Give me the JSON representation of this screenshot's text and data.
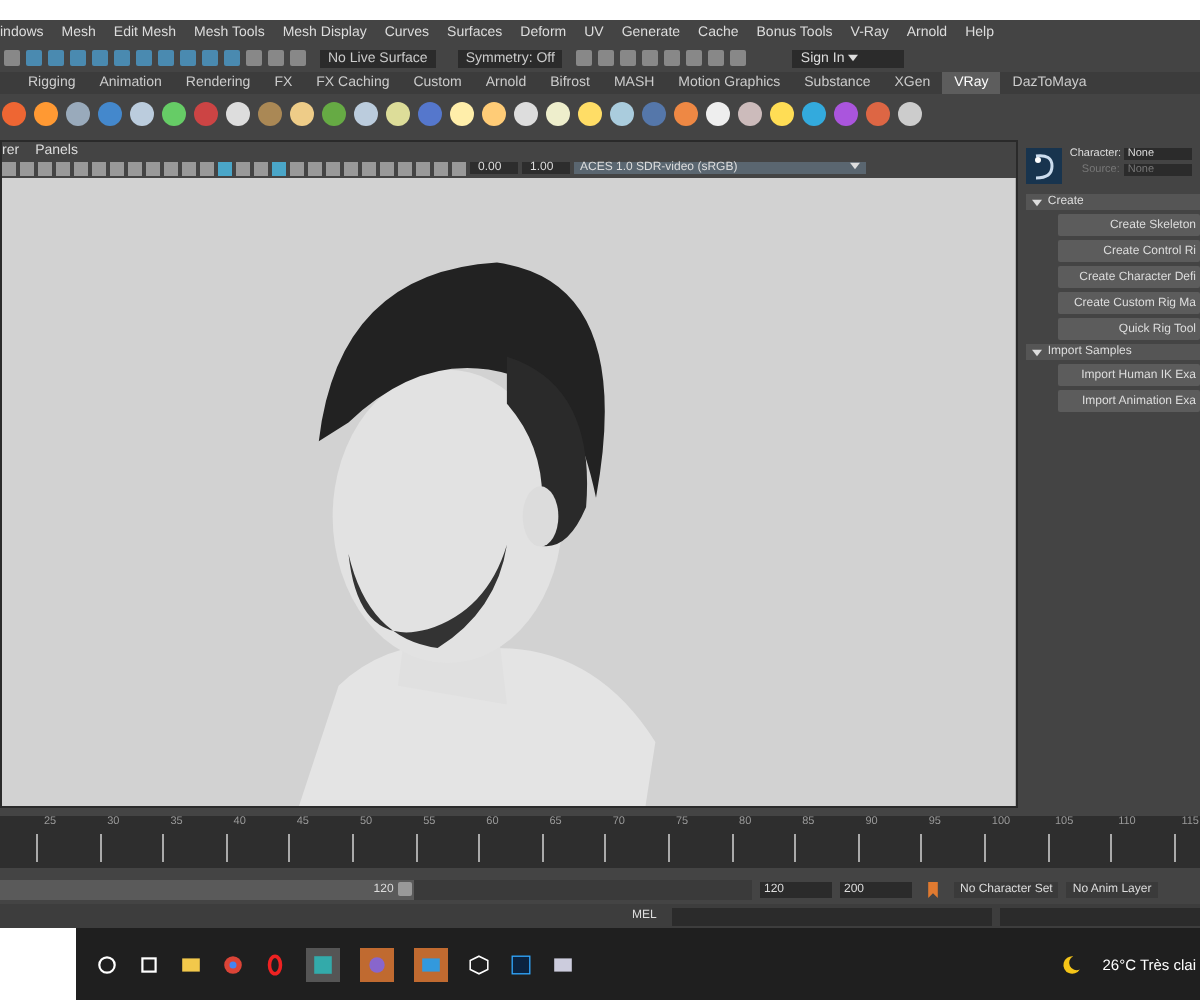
{
  "menu": [
    "indows",
    "Mesh",
    "Edit Mesh",
    "Mesh Tools",
    "Mesh Display",
    "Curves",
    "Surfaces",
    "Deform",
    "UV",
    "Generate",
    "Cache",
    "Bonus Tools",
    "V-Ray",
    "Arnold",
    "Help"
  ],
  "status_line": {
    "live_surface": "No Live Surface",
    "symmetry": "Symmetry: Off",
    "sign_in": "Sign In"
  },
  "shelf_tabs": [
    {
      "label": "Rigging",
      "selected": false
    },
    {
      "label": "Animation",
      "selected": false
    },
    {
      "label": "Rendering",
      "selected": false
    },
    {
      "label": "FX",
      "selected": false
    },
    {
      "label": "FX Caching",
      "selected": false
    },
    {
      "label": "Custom",
      "selected": false
    },
    {
      "label": "Arnold",
      "selected": false
    },
    {
      "label": "Bifrost",
      "selected": false
    },
    {
      "label": "MASH",
      "selected": false
    },
    {
      "label": "Motion Graphics",
      "selected": false
    },
    {
      "label": "Substance",
      "selected": false
    },
    {
      "label": "XGen",
      "selected": false
    },
    {
      "label": "VRay",
      "selected": true
    },
    {
      "label": "DazToMaya",
      "selected": false
    }
  ],
  "viewport": {
    "menu": [
      "rer",
      "Panels"
    ],
    "exposure": "0.00",
    "gamma": "1.00",
    "color_space": "ACES 1.0 SDR-video (sRGB)"
  },
  "hik_panel": {
    "character_label": "Character:",
    "character": "None",
    "source_label": "Source:",
    "source": "None",
    "sections": [
      {
        "title": "Create",
        "expanded": true,
        "buttons": [
          "Create Skeleton",
          "Create Control Ri",
          "Create Character Defi",
          "Create Custom Rig Ma",
          "Quick Rig Tool"
        ]
      },
      {
        "title": "Import Samples",
        "expanded": true,
        "buttons": [
          "Import Human IK Exa",
          "Import Animation Exa"
        ]
      }
    ]
  },
  "timeline": {
    "ticks": [
      "25",
      "30",
      "35",
      "40",
      "45",
      "50",
      "55",
      "60",
      "65",
      "70",
      "75",
      "80",
      "85",
      "90",
      "95",
      "100",
      "105",
      "110",
      "115"
    ]
  },
  "range": {
    "level": 0.55,
    "handle": "120",
    "end": "120",
    "max": "200",
    "character_set": "No Character Set",
    "anim_layer": "No Anim Layer"
  },
  "command_line": {
    "label": "MEL"
  },
  "taskbar": {
    "weather": "26°C Très clai"
  }
}
